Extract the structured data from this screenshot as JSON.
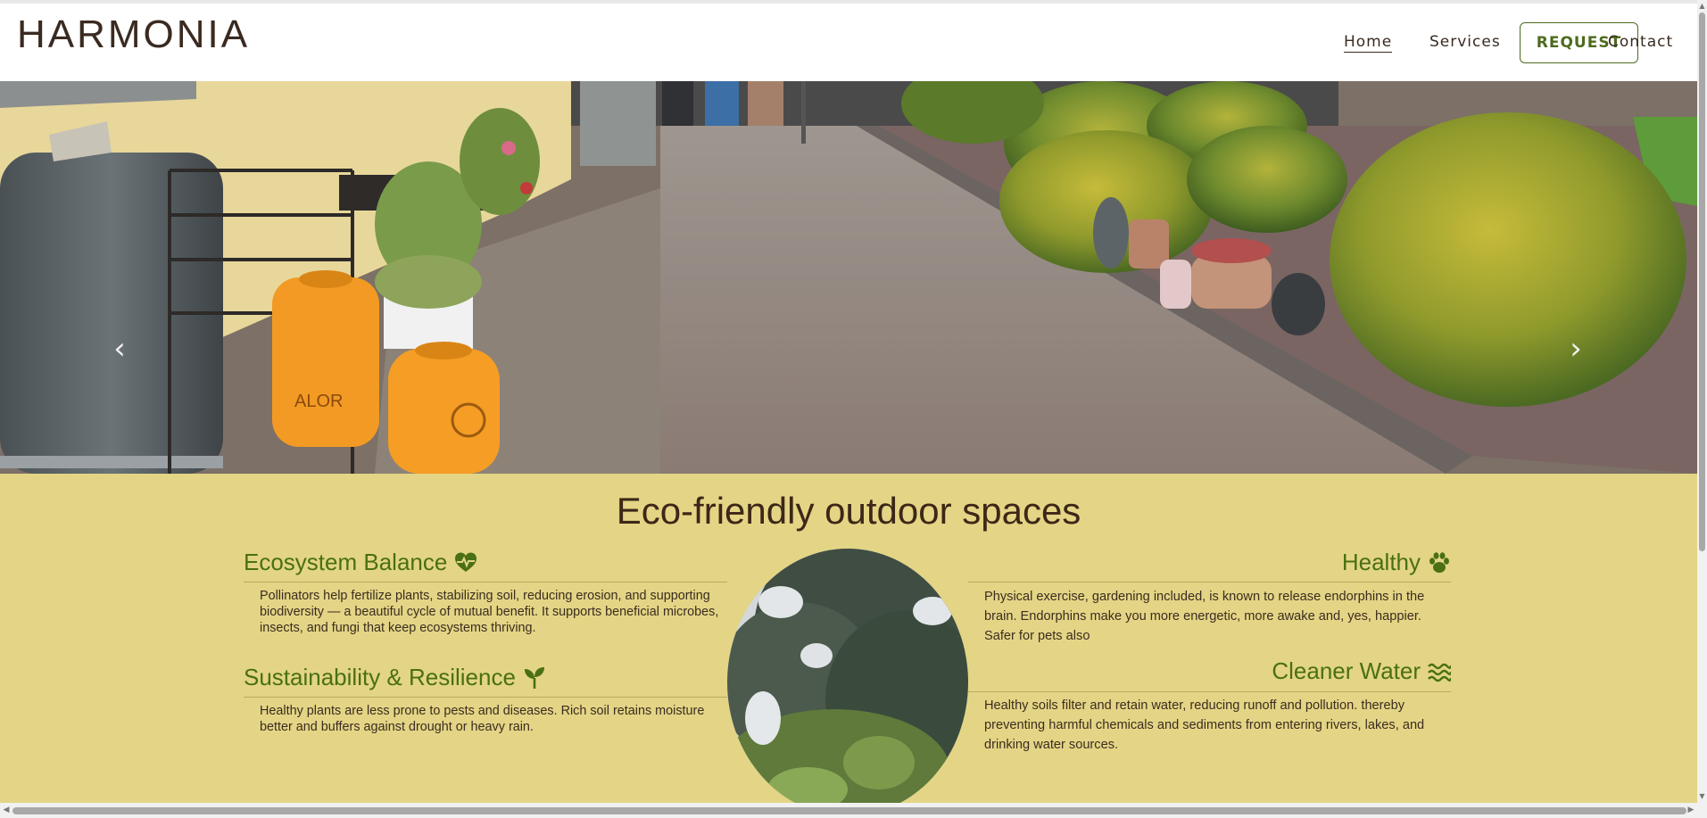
{
  "brand": {
    "logo": "HARMONIA"
  },
  "nav": {
    "home": "Home",
    "services": "Services",
    "request": "REQUEST",
    "contact": "Contact"
  },
  "hero": {
    "image": "garden-path-photo",
    "prev_icon": "chevron-left-icon",
    "next_icon": "chevron-right-icon",
    "prev_glyph": "‹",
    "next_glyph": "›"
  },
  "section": {
    "title": "Eco-friendly outdoor spaces",
    "center_image": "tree-photo-oval",
    "features": [
      {
        "title": "Ecosystem Balance",
        "icon": "heart-pulse-icon",
        "text": "Pollinators help fertilize plants, stabilizing soil, reducing erosion, and supporting biodiversity — a beautiful cycle of mutual benefit. It supports beneficial microbes, insects, and fungi that keep ecosystems thriving."
      },
      {
        "title": "Sustainability & Resilience",
        "icon": "seedling-icon",
        "text": "Healthy plants are less prone to pests and diseases. Rich soil retains moisture better and buffers against drought or heavy rain."
      },
      {
        "title": "Healthy",
        "icon": "paw-icon",
        "text": "Physical exercise, gardening included, is known to release endorphins in the brain. Endorphins make you more energetic, more awake and, yes, happier. Safer for pets also"
      },
      {
        "title": "Cleaner Water",
        "icon": "water-waves-icon",
        "text": "Healthy soils filter and retain water, reducing runoff and pollution. thereby preventing harmful chemicals and sediments from entering rivers, lakes, and drinking water sources."
      }
    ]
  },
  "colors": {
    "brand_text": "#3a2a20",
    "accent_green": "#4a6f14",
    "section_bg": "#e3d585"
  }
}
